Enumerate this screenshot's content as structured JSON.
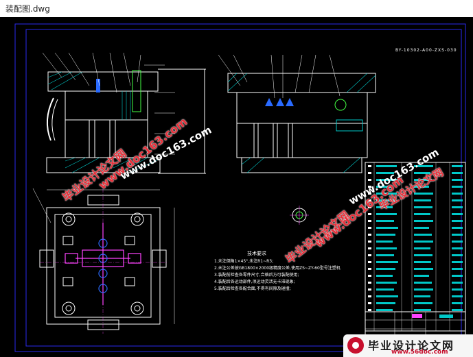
{
  "window": {
    "title": "装配图.dwg"
  },
  "drawing": {
    "drawing_number": "BY-10302-A00-ZXS-030",
    "notes_title": "技术要求",
    "notes": [
      "1.未注倒角1×45°,未注R1~R3;",
      "2.未注公差按GB1800×2000级精度公差,使用ZS~ZY-60型号注塑机",
      "3.装配前检查各零件尺寸,合格后方可装配使用;",
      "4.装配后各运动部件,须运动灵活无卡滞现象;",
      "5.装配后检查各配合面,不得有间隙及碰撞;"
    ]
  },
  "watermarks": {
    "site_cn": "毕业设计论文网",
    "site_url": "www.doc163.com",
    "banner_url": "www.56doc.com"
  },
  "colors": {
    "background": "#000000",
    "frame": "#2a2af0",
    "outline": "#ffffff",
    "hatch": "#00c8c8",
    "highlight": "#ff44ff",
    "accent_green": "#44ff44",
    "watermark_red": "#e8303a"
  }
}
